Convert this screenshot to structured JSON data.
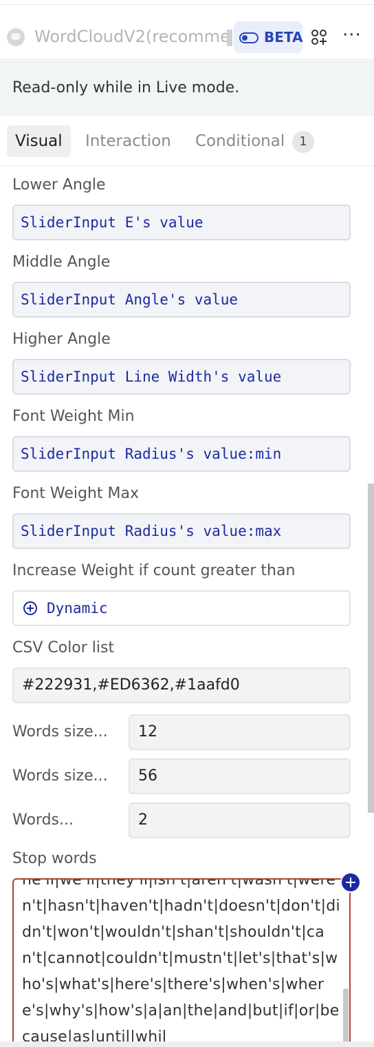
{
  "header": {
    "component_name": "WordCloudV2(recomme",
    "beta_label": "BETA",
    "icons": [
      "component-icon",
      "toggle-icon",
      "shapes-icon",
      "more-icon"
    ]
  },
  "banner": {
    "text": "Read-only while in Live mode."
  },
  "tabs": [
    {
      "label": "Visual",
      "active": true
    },
    {
      "label": "Interaction",
      "active": false
    },
    {
      "label": "Conditional",
      "active": false,
      "badge": "1"
    }
  ],
  "fields": {
    "lower_angle": {
      "label": "Lower Angle",
      "value": "SliderInput E's value"
    },
    "middle_angle": {
      "label": "Middle Angle",
      "value": "SliderInput Angle's value"
    },
    "higher_angle": {
      "label": "Higher Angle",
      "value": "SliderInput Line Width's value"
    },
    "font_weight_min": {
      "label": "Font Weight Min",
      "value": "SliderInput Radius's value:min"
    },
    "font_weight_max": {
      "label": "Font Weight Max",
      "value": "SliderInput Radius's value:max"
    },
    "increase_weight": {
      "label": "Increase Weight if count greater than",
      "value": "Dynamic"
    },
    "csv_color_list": {
      "label": "CSV Color list",
      "value": "#222931,#ED6362,#1aafd0"
    },
    "words_size_min": {
      "label": "Words size...",
      "value": "12"
    },
    "words_size_max": {
      "label": "Words size...",
      "value": "56"
    },
    "words_other": {
      "label": "Words...",
      "value": "2"
    },
    "stop_words": {
      "label": "Stop words",
      "value": "he'll|we'll|they'll|isn't|aren't|wasn't|weren't|hasn't|haven't|hadn't|doesn't|don't|didn't|won't|wouldn't|shan't|shouldn't|can't|cannot|couldn't|mustn't|let's|that's|who's|what's|here's|there's|when's|where's|why's|how's|a|an|the|and|but|if|or|because|as|until|whil"
    }
  },
  "colors": {
    "accent": "#1d2a9e",
    "beta_bg": "#e8eefb",
    "banner_bg": "#f0f6f1",
    "error_border": "#b3422b"
  }
}
